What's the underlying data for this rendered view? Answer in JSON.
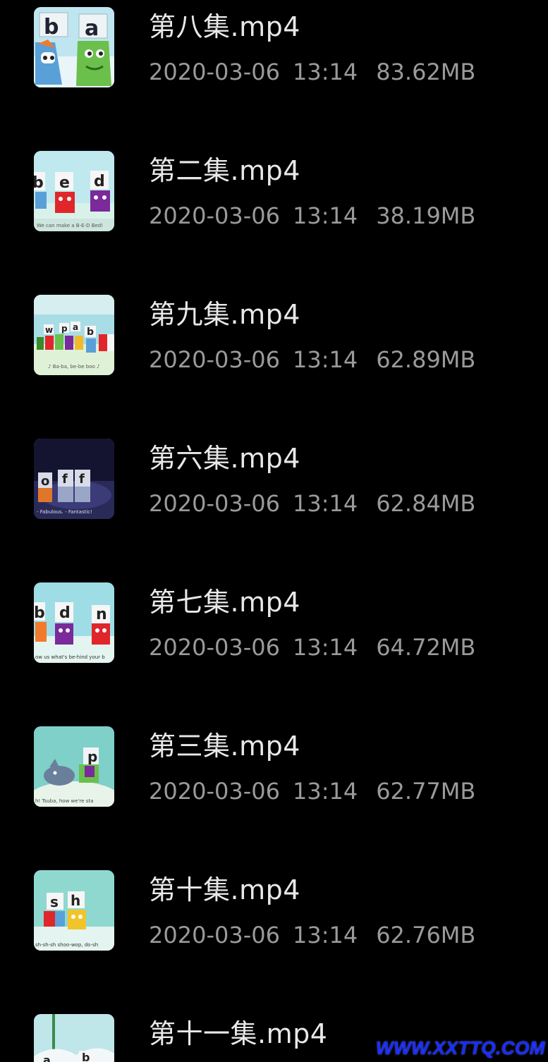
{
  "files": [
    {
      "name": "第八集.mp4",
      "date": "2020-03-06",
      "time": "13:14",
      "size": "83.62MB",
      "thumb_letters": [
        "b",
        "a"
      ],
      "thumb_caption": ""
    },
    {
      "name": "第二集.mp4",
      "date": "2020-03-06",
      "time": "13:14",
      "size": "38.19MB",
      "thumb_letters": [
        "b",
        "e",
        "d"
      ],
      "thumb_caption": "We can make a B-E-D Bed!"
    },
    {
      "name": "第九集.mp4",
      "date": "2020-03-06",
      "time": "13:14",
      "size": "62.89MB",
      "thumb_letters": [
        "w",
        "p",
        "a",
        "b"
      ],
      "thumb_caption": "♪ Ba-ba, be-be boo ♪"
    },
    {
      "name": "第六集.mp4",
      "date": "2020-03-06",
      "time": "13:14",
      "size": "62.84MB",
      "thumb_letters": [
        "o",
        "f",
        "f"
      ],
      "thumb_caption": "- Fabulous. - Fantastic!"
    },
    {
      "name": "第七集.mp4",
      "date": "2020-03-06",
      "time": "13:14",
      "size": "64.72MB",
      "thumb_letters": [
        "b",
        "d",
        "n"
      ],
      "thumb_caption": "ow us what's be-hind your b"
    },
    {
      "name": "第三集.mp4",
      "date": "2020-03-06",
      "time": "13:14",
      "size": "62.77MB",
      "thumb_letters": [
        "p"
      ],
      "thumb_caption": "h! Tsuba, how we're sta"
    },
    {
      "name": "第十集.mp4",
      "date": "2020-03-06",
      "time": "13:14",
      "size": "62.76MB",
      "thumb_letters": [
        "s",
        "h"
      ],
      "thumb_caption": "sh-sh-sh shoo-wop, do-sh"
    },
    {
      "name": "第十一集.mp4",
      "date": "",
      "time": "",
      "size": "",
      "thumb_letters": [
        "a",
        "b"
      ],
      "thumb_caption": ""
    }
  ],
  "watermark": "WWW.XXTTQ.COM",
  "colors": {
    "background": "#000000",
    "name_text": "#e8e8e8",
    "meta_text": "#9a9a9a",
    "watermark": "#1a2cff"
  }
}
